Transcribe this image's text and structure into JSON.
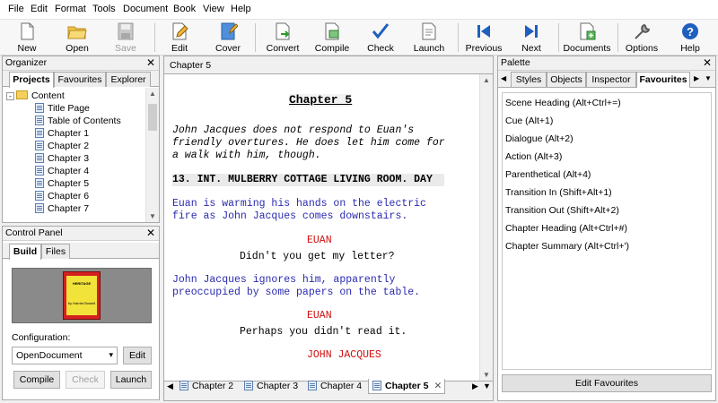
{
  "menu": [
    "File",
    "Edit",
    "Format",
    "Tools",
    "Document",
    "Book",
    "View",
    "Help"
  ],
  "toolbar": {
    "new": "New",
    "open": "Open",
    "save": "Save",
    "edit": "Edit",
    "cover": "Cover",
    "convert": "Convert",
    "compile": "Compile",
    "check": "Check",
    "launch": "Launch",
    "previous": "Previous",
    "next": "Next",
    "documents": "Documents",
    "options": "Options",
    "help": "Help"
  },
  "organizer": {
    "title": "Organizer",
    "tabs": [
      "Projects",
      "Favourites",
      "Explorer"
    ],
    "root": "Content",
    "items": [
      "Title Page",
      "Table of Contents",
      "Chapter 1",
      "Chapter 2",
      "Chapter 3",
      "Chapter 4",
      "Chapter 5",
      "Chapter 6",
      "Chapter 7"
    ]
  },
  "control_panel": {
    "title": "Control Panel",
    "tabs": [
      "Build",
      "Files"
    ],
    "cover_title": "HERITAGE",
    "cover_author": "by Harriet Bostell",
    "config_label": "Configuration:",
    "config_value": "OpenDocument",
    "edit_btn": "Edit",
    "compile_btn": "Compile",
    "check_btn": "Check",
    "launch_btn": "Launch"
  },
  "editor": {
    "title": "Chapter 5",
    "heading": "Chapter 5",
    "para1": "John Jacques does not respond to Euan's\nfriendly overtures. He does let him come for\na walk with him, though.",
    "scene": "13. INT. MULBERRY COTTAGE LIVING ROOM. DAY",
    "action1": "Euan is warming his hands on the electric\nfire as John Jacques comes downstairs.",
    "char1": "EUAN",
    "dial1": "Didn't you get my letter?",
    "action2": "John Jacques ignores him, apparently\npreoccupied by some papers on the table.",
    "char2": "EUAN",
    "dial2": "Perhaps you didn't read it.",
    "char3": "JOHN JACQUES",
    "bottom_tabs": [
      "Chapter 2",
      "Chapter 3",
      "Chapter 4",
      "Chapter 5"
    ]
  },
  "palette": {
    "title": "Palette",
    "tabs": [
      "Styles",
      "Objects",
      "Inspector",
      "Favourites"
    ],
    "items": [
      "Scene Heading (Alt+Ctrl+=)",
      "Cue (Alt+1)",
      "Dialogue (Alt+2)",
      "Action (Alt+3)",
      "Parenthetical (Alt+4)",
      "Transition In (Shift+Alt+1)",
      "Transition Out (Shift+Alt+2)",
      "Chapter Heading (Alt+Ctrl+#)",
      "Chapter Summary (Alt+Ctrl+')"
    ],
    "edit_btn": "Edit Favourites"
  },
  "colors": {
    "action": "#2a2ab0",
    "character": "#d01010",
    "accent": "#1e5fbf"
  }
}
